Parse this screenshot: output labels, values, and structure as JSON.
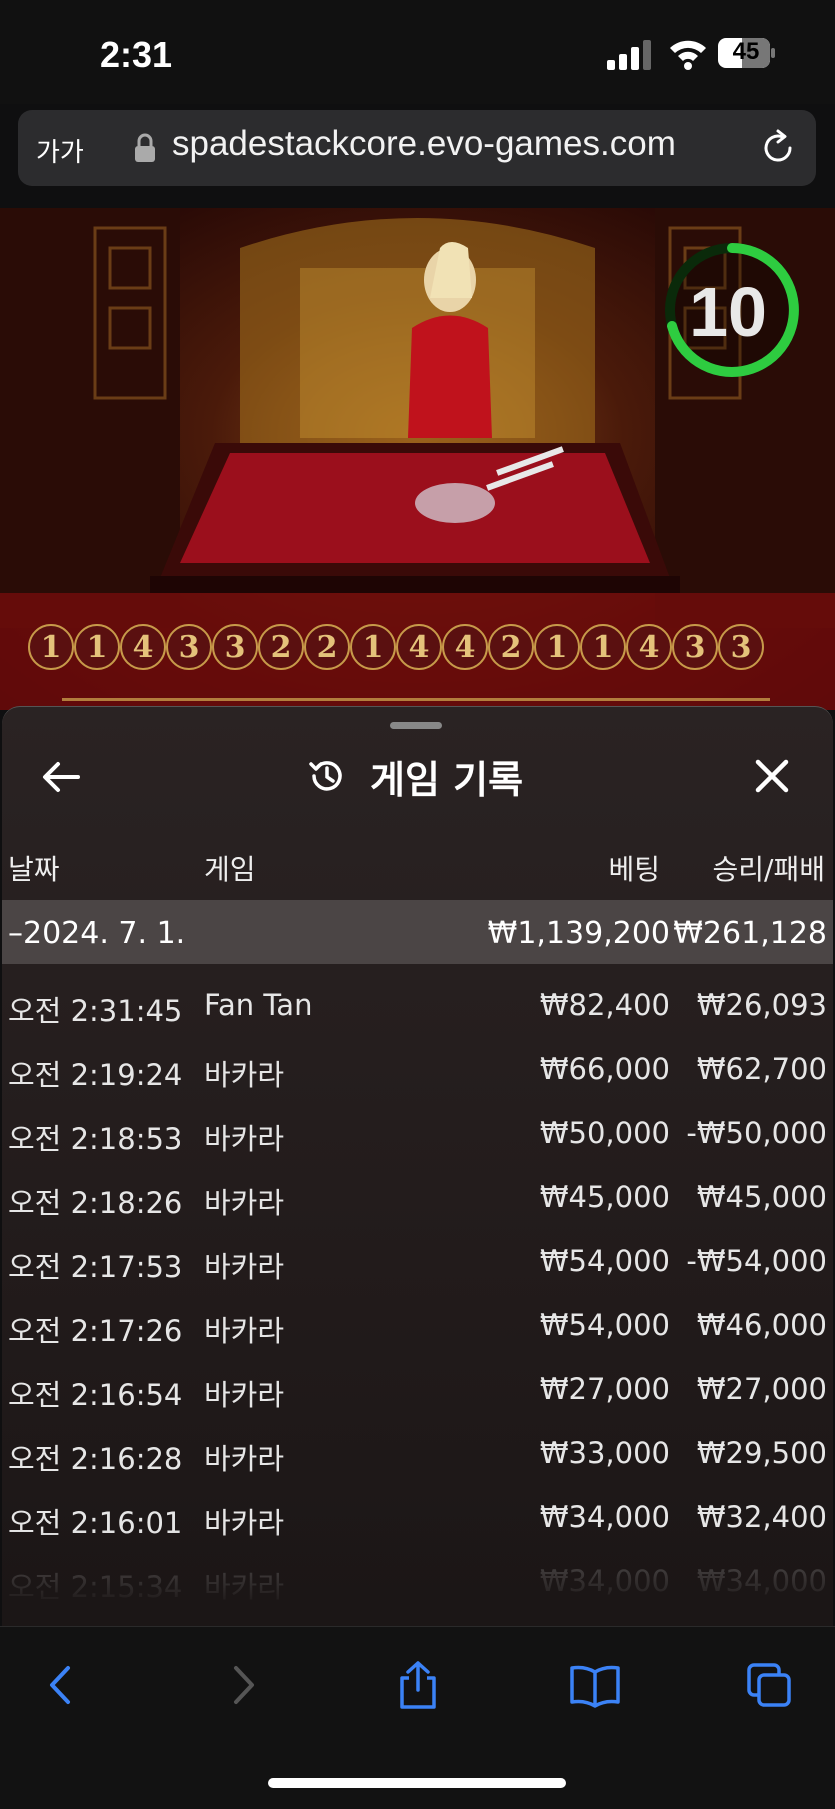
{
  "status_bar": {
    "time": "2:31",
    "battery": "45"
  },
  "address_bar": {
    "text_size_label": "가가",
    "url": "spadestackcore.evo-games.com"
  },
  "game": {
    "timer": "10",
    "road": [
      "1",
      "1",
      "4",
      "3",
      "3",
      "2",
      "2",
      "1",
      "4",
      "4",
      "2",
      "1",
      "1",
      "4",
      "3",
      "3"
    ],
    "colors": {
      "timer_ring": "#2ecc40",
      "road_gold": "#c79a4a"
    }
  },
  "panel": {
    "title": "게임 기록",
    "columns": {
      "date": "날짜",
      "game": "게임",
      "bet": "베팅",
      "winloss": "승리/패배"
    },
    "summary": {
      "date": "–2024. 7. 1.",
      "bet": "₩1,139,200",
      "winloss": "₩261,128"
    },
    "rows": [
      {
        "time": "오전 2:31:45",
        "game": "Fan Tan",
        "bet": "₩82,400",
        "winloss": "₩26,093"
      },
      {
        "time": "오전 2:19:24",
        "game": "바카라",
        "bet": "₩66,000",
        "winloss": "₩62,700"
      },
      {
        "time": "오전 2:18:53",
        "game": "바카라",
        "bet": "₩50,000",
        "winloss": "-₩50,000"
      },
      {
        "time": "오전 2:18:26",
        "game": "바카라",
        "bet": "₩45,000",
        "winloss": "₩45,000"
      },
      {
        "time": "오전 2:17:53",
        "game": "바카라",
        "bet": "₩54,000",
        "winloss": "-₩54,000"
      },
      {
        "time": "오전 2:17:26",
        "game": "바카라",
        "bet": "₩54,000",
        "winloss": "₩46,000"
      },
      {
        "time": "오전 2:16:54",
        "game": "바카라",
        "bet": "₩27,000",
        "winloss": "₩27,000"
      },
      {
        "time": "오전 2:16:28",
        "game": "바카라",
        "bet": "₩33,000",
        "winloss": "₩29,500"
      },
      {
        "time": "오전 2:16:01",
        "game": "바카라",
        "bet": "₩34,000",
        "winloss": "₩32,400"
      },
      {
        "time": "오전 2:15:34",
        "game": "바카라",
        "bet": "₩34,000",
        "winloss": "₩34,000"
      }
    ]
  },
  "toolbar": {
    "icons": [
      "back-icon",
      "forward-icon",
      "share-icon",
      "bookmarks-icon",
      "tabs-icon"
    ]
  }
}
